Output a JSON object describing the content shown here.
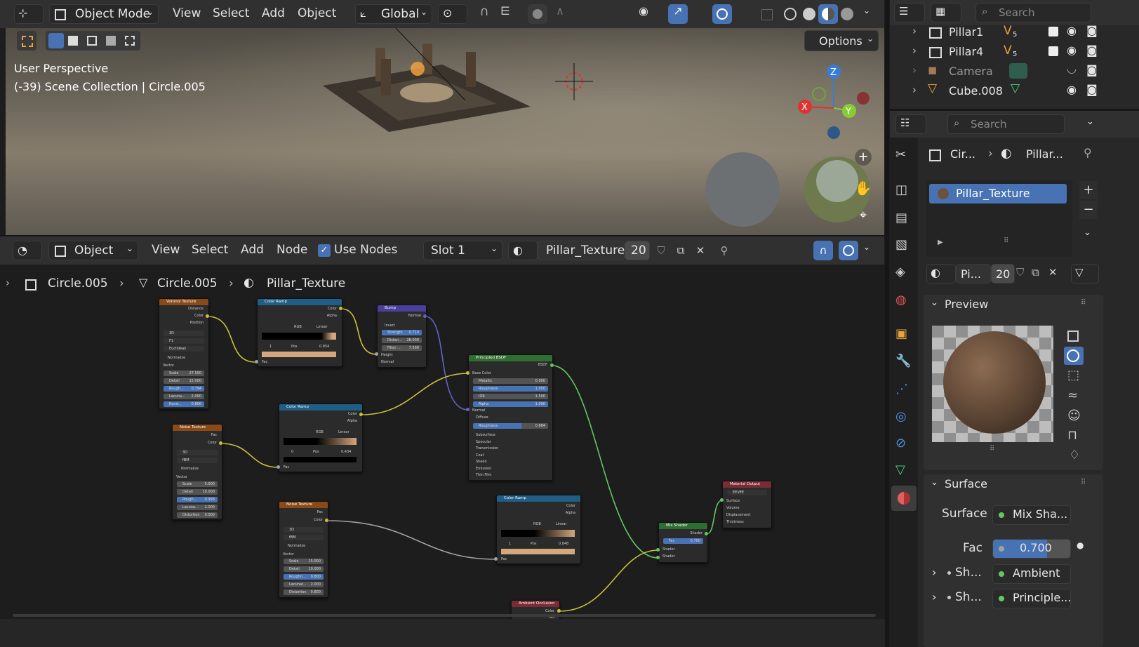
{
  "viewport": {
    "mode_label": "Object Mode",
    "menus": [
      "View",
      "Select",
      "Add",
      "Object"
    ],
    "transform_orientation": "Global",
    "options_label": "Options",
    "perspective_label": "User Perspective",
    "scene_info": "(-39) Scene Collection | Circle.005",
    "gizmo": {
      "z": "Z",
      "x": "X",
      "y": "Y"
    }
  },
  "node_editor": {
    "object_label": "Object",
    "menus": [
      "View",
      "Select",
      "Add",
      "Node"
    ],
    "use_nodes_label": "Use Nodes",
    "slot_label": "Slot 1",
    "material_name": "Pillar_Texture",
    "user_count": "20",
    "breadcrumb": [
      "Circle.005",
      "Circle.005",
      "Pillar_Texture"
    ]
  },
  "nodes": {
    "voronoi": {
      "title": "Voronoi Texture",
      "outputs": [
        "Distance",
        "Color",
        "Position"
      ],
      "dims": "3D",
      "feature": "F1",
      "metric": "Euclidean",
      "normalize": "Normalize",
      "vector": "Vector",
      "fields": [
        {
          "l": "Scale",
          "v": "27.500"
        },
        {
          "l": "Detail",
          "v": "15.000"
        },
        {
          "l": "Rough...",
          "v": "0.794"
        },
        {
          "l": "Lacuna...",
          "v": "2.000"
        },
        {
          "l": "Rand...",
          "v": "0.800"
        }
      ]
    },
    "ramp1": {
      "title": "Color Ramp",
      "outputs": [
        "Color",
        "Alpha"
      ],
      "mode": "RGB",
      "interp": "Linear",
      "index": "1",
      "pos_label": "Pos",
      "pos": "0.954",
      "fac": "Fac"
    },
    "bump": {
      "title": "Bump",
      "output": "Normal",
      "invert": "Invert",
      "fields": [
        {
          "l": "Strength",
          "v": "0.710"
        },
        {
          "l": "Distan...",
          "v": "28.000"
        },
        {
          "l": "Filter ...",
          "v": "7.500"
        }
      ],
      "inputs": [
        "Height",
        "Normal"
      ]
    },
    "bsdf": {
      "title": "Principled BSDF",
      "output": "BSDF",
      "base": "Base Color",
      "fields": [
        {
          "l": "Metallic",
          "v": "0.000"
        },
        {
          "l": "Roughness",
          "v": "1.000"
        },
        {
          "l": "IOR",
          "v": "1.500"
        },
        {
          "l": "Alpha",
          "v": "1.000"
        }
      ],
      "normal": "Normal",
      "diffuse": "Diffuse",
      "rough2": {
        "l": "Roughness",
        "v": "0.684"
      },
      "sections": [
        "Subsurface",
        "Specular",
        "Transmission",
        "Coat",
        "Sheen",
        "Emission",
        "Thin Film"
      ]
    },
    "noise1": {
      "title": "Noise Texture",
      "outputs": [
        "Fac",
        "Color"
      ],
      "dims": "3D",
      "type": "fBM",
      "normalize": "Normalize",
      "vector": "Vector",
      "fields": [
        {
          "l": "Scale",
          "v": "5.000"
        },
        {
          "l": "Detail",
          "v": "10.000"
        },
        {
          "l": "Rough...",
          "v": "0.993"
        },
        {
          "l": "Lacuna...",
          "v": "2.000"
        },
        {
          "l": "Distortion",
          "v": "0.000"
        }
      ]
    },
    "ramp2": {
      "title": "Color Ramp",
      "outputs": [
        "Color",
        "Alpha"
      ],
      "mode": "RGB",
      "interp": "Linear",
      "index": "0",
      "pos_label": "Pos",
      "pos": "0.434",
      "fac": "Fac"
    },
    "noise2": {
      "title": "Noise Texture",
      "outputs": [
        "Fac",
        "Color"
      ],
      "dims": "3D",
      "type": "fBM",
      "normalize": "Normalize",
      "vector": "Vector",
      "fields": [
        {
          "l": "Scale",
          "v": "15.000"
        },
        {
          "l": "Detail",
          "v": "10.000"
        },
        {
          "l": "Roughn...",
          "v": "0.800"
        },
        {
          "l": "Lacunar...",
          "v": "2.000"
        },
        {
          "l": "Distortion",
          "v": "0.800"
        }
      ]
    },
    "ramp3": {
      "title": "Color Ramp",
      "outputs": [
        "Color",
        "Alpha"
      ],
      "mode": "RGB",
      "interp": "Linear",
      "index": "1",
      "pos_label": "Pos",
      "pos": "0.848",
      "fac": "Fac"
    },
    "mix": {
      "title": "Mix Shader",
      "output": "Shader",
      "fac_label": "Fac",
      "fac": "0.700",
      "inputs": [
        "Shader",
        "Shader"
      ]
    },
    "output": {
      "title": "Material Output",
      "target": "EEVEE",
      "inputs": [
        "Surface",
        "Volume",
        "Displacement",
        "Thickness"
      ]
    },
    "ao": {
      "title": "Ambient Occlusion",
      "output": "Color",
      "output2": "AO"
    }
  },
  "outliner": {
    "search_placeholder": "Search",
    "rows": [
      {
        "name": "Pillar1",
        "badge": "5"
      },
      {
        "name": "Pillar4",
        "badge": "5"
      },
      {
        "name": "Camera",
        "badge": ""
      },
      {
        "name": "Cube.008",
        "badge": ""
      }
    ]
  },
  "properties": {
    "search_placeholder": "Search",
    "breadcrumb_obj": "Cir...",
    "breadcrumb_mat": "Pillar...",
    "slot_item": "Pillar_Texture",
    "mat_short": "Pi...",
    "user_count": "20",
    "preview_label": "Preview",
    "surface_label": "Surface",
    "surface_field_label": "Surface",
    "surface_value": "Mix Sha...",
    "fac_label": "Fac",
    "fac_value": "0.700",
    "sh1_label": "Sh...",
    "sh1_value": "Ambient ...",
    "sh2_label": "Sh...",
    "sh2_value": "Principle..."
  },
  "colors": {
    "accent_blue": "#4772b3",
    "header_bg": "#303030",
    "texture_node": "#8a4a18",
    "converter_node": "#1f5e85",
    "vector_node": "#4a3f9a",
    "shader_node": "#2f6e31",
    "output_node": "#7a2b35",
    "link_yellow": "#c7c23a",
    "link_green": "#63c763",
    "link_purple": "#6363c7",
    "link_grey": "#a1a1a1"
  }
}
